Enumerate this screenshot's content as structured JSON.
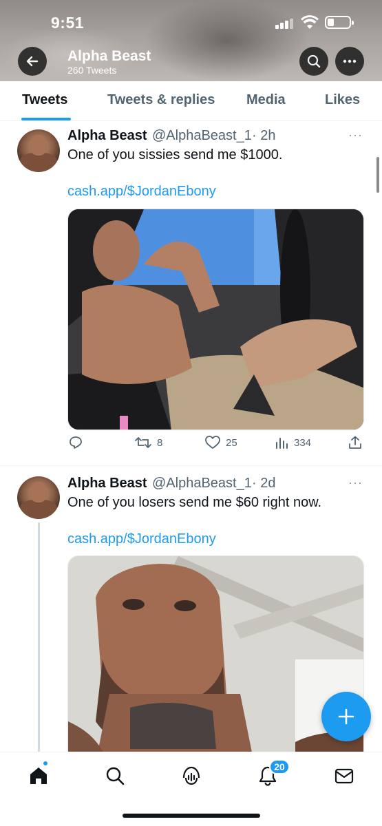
{
  "status_bar": {
    "time": "9:51"
  },
  "header": {
    "title": "Alpha Beast",
    "subtitle": "260 Tweets"
  },
  "tabs": [
    {
      "label": "Tweets",
      "active": true
    },
    {
      "label": "Tweets & replies"
    },
    {
      "label": "Media"
    },
    {
      "label": "Likes"
    }
  ],
  "tweets": [
    {
      "name": "Alpha Beast",
      "handle": "@AlphaBeast_1",
      "time": "· 2h",
      "more": "···",
      "text": "One of you sissies send me $1000.",
      "link": "cash.app/$JordanEbony",
      "image": "photo: shirtless tattooed man flexing in a car with foot on the steering wheel",
      "replies": "",
      "retweets": "8",
      "likes": "25",
      "views": "334"
    },
    {
      "name": "Alpha Beast",
      "handle": "@AlphaBeast_1",
      "time": "· 2d",
      "more": "···",
      "text": "One of you losers send me $60 right now.",
      "link": "cash.app/$JordanEbony",
      "image": "photo: close-up selfie of bearded man with neck tattoo under an office ceiling"
    }
  ],
  "bottom_nav": {
    "items": [
      "home-icon",
      "search-icon",
      "spaces-icon",
      "notifications-icon",
      "messages-icon"
    ],
    "notifications_badge": "20"
  },
  "colors": {
    "accent": "#1d9bf0",
    "text": "#0f1419",
    "secondary": "#536471"
  }
}
